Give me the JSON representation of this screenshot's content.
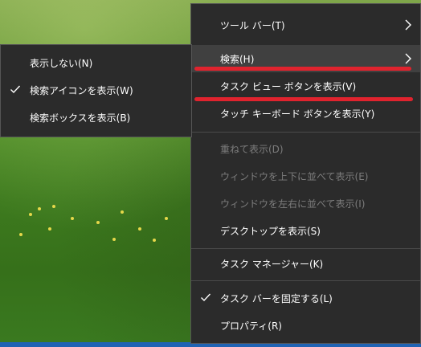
{
  "context_menu": {
    "items": [
      {
        "label": "ツール バー(T)"
      },
      {
        "label": "検索(H)"
      },
      {
        "label": "タスク ビュー ボタンを表示(V)"
      },
      {
        "label": "タッチ キーボード ボタンを表示(Y)"
      },
      {
        "label": "重ねて表示(D)"
      },
      {
        "label": "ウィンドウを上下に並べて表示(E)"
      },
      {
        "label": "ウィンドウを左右に並べて表示(I)"
      },
      {
        "label": "デスクトップを表示(S)"
      },
      {
        "label": "タスク マネージャー(K)"
      },
      {
        "label": "タスク バーを固定する(L)"
      },
      {
        "label": "プロパティ(R)"
      }
    ]
  },
  "search_submenu": {
    "items": [
      {
        "label": "表示しない(N)"
      },
      {
        "label": "検索アイコンを表示(W)"
      },
      {
        "label": "検索ボックスを表示(B)"
      }
    ]
  },
  "colors": {
    "menu_background": "#2b2b2b",
    "hover_background": "#404040",
    "highlight_line": "#e0232e",
    "disabled_text": "#7c7c7c"
  }
}
